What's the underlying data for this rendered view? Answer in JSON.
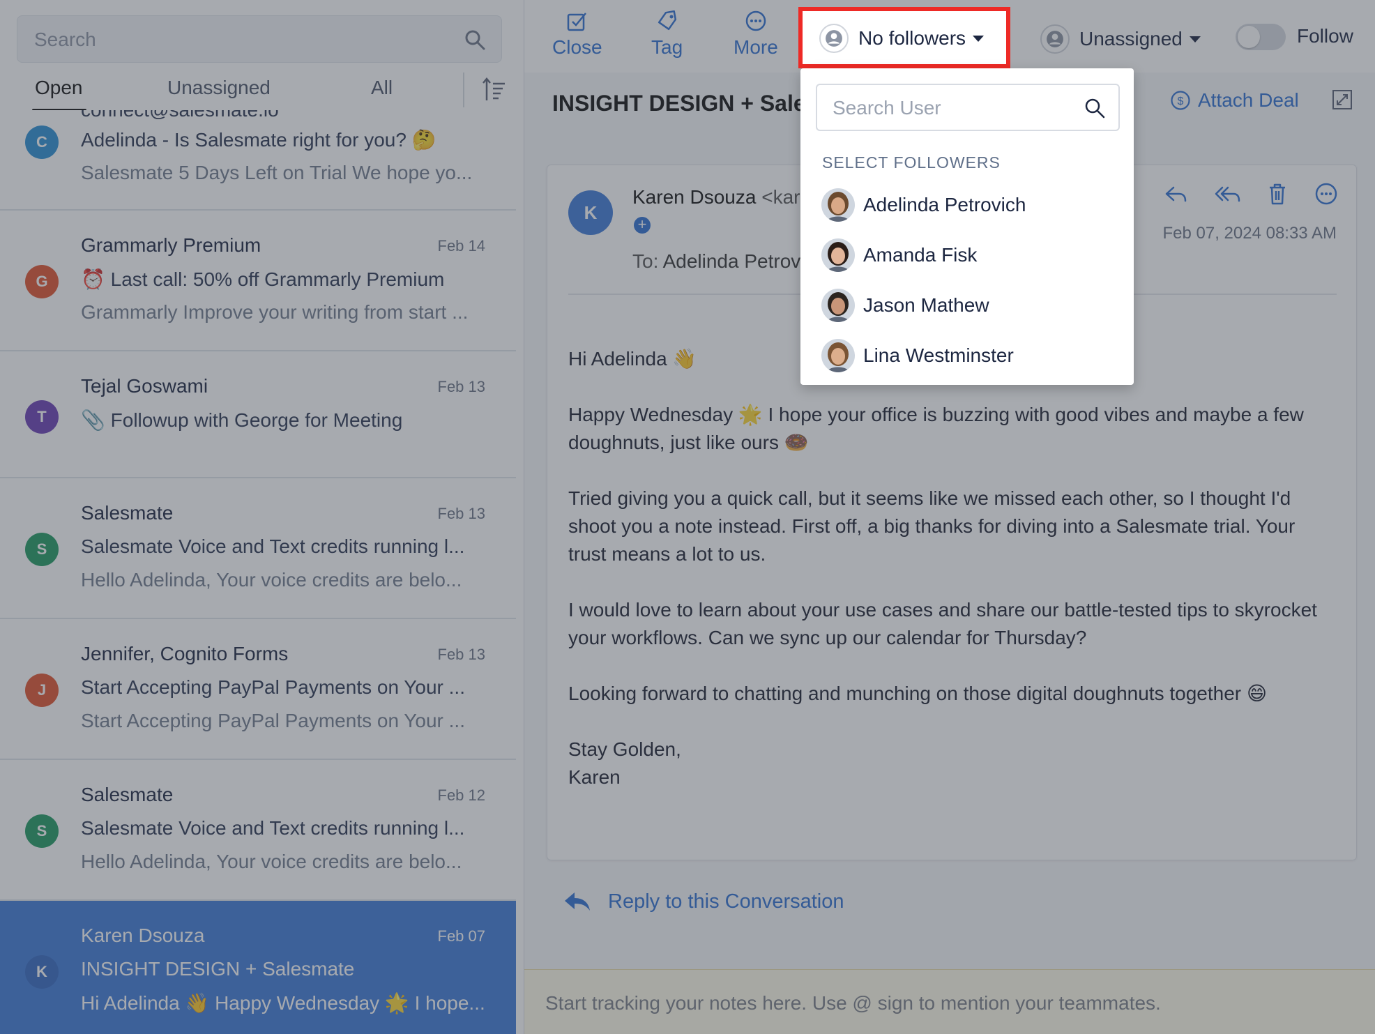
{
  "left_panel": {
    "search": {
      "placeholder": "Search",
      "value": ""
    },
    "tabs": [
      {
        "label": "Open",
        "active": true
      },
      {
        "label": "Unassigned",
        "active": false
      },
      {
        "label": "All",
        "active": false
      }
    ],
    "partial_top_text": "connect@salesmate.io",
    "conversations": [
      {
        "initial": "C",
        "avatar_color": "#2a8fd4",
        "sender": "",
        "date": "",
        "subject": "Adelinda - Is Salesmate right for you? 🤔",
        "preview": "Salesmate 5 Days Left on Trial We hope yo..."
      },
      {
        "initial": "G",
        "avatar_color": "#e0532e",
        "sender": "Grammarly Premium",
        "date": "Feb 14",
        "subject": "⏰ Last call: 50% off Grammarly Premium",
        "preview": "Grammarly Improve your writing from start ..."
      },
      {
        "initial": "T",
        "avatar_color": "#6a3fb4",
        "sender": "Tejal Goswami",
        "date": "Feb 13",
        "subject": "📎 Followup with George for Meeting",
        "preview": ""
      },
      {
        "initial": "S",
        "avatar_color": "#1f9a62",
        "sender": "Salesmate",
        "date": "Feb 13",
        "subject": "Salesmate Voice and Text credits running l...",
        "preview": "Hello Adelinda, Your voice credits are belo..."
      },
      {
        "initial": "J",
        "avatar_color": "#e0532e",
        "sender": "Jennifer, Cognito Forms",
        "date": "Feb 13",
        "subject": "Start Accepting PayPal Payments on Your ...",
        "preview": "Start Accepting PayPal Payments on Your ..."
      },
      {
        "initial": "S",
        "avatar_color": "#1f9a62",
        "sender": "Salesmate",
        "date": "Feb 12",
        "subject": "Salesmate Voice and Text credits running l...",
        "preview": "Hello Adelinda, Your voice credits are belo..."
      },
      {
        "initial": "K",
        "avatar_color": "#3468c2",
        "sender": "Karen Dsouza",
        "date": "Feb 07",
        "subject": "INSIGHT DESIGN + Salesmate",
        "preview": "Hi Adelinda 👋 Happy Wednesday 🌟 I hope...",
        "selected": true
      }
    ]
  },
  "toolbar": {
    "close_label": "Close",
    "tag_label": "Tag",
    "more_label": "More",
    "followers_label": "No followers",
    "assignee_label": "Unassigned",
    "follow_label": "Follow",
    "follow_on": false
  },
  "conversation": {
    "title": "INSIGHT DESIGN + Salesmate",
    "attach_deal_label": "Attach Deal"
  },
  "email": {
    "avatar_initial": "K",
    "from_name": "Karen Dsouza",
    "from_email": "<karen@insightdesign.com>",
    "to_label": "To:",
    "to_value": "Adelinda Petrovich",
    "timestamp": "Feb 07, 2024 08:33 AM",
    "body": [
      "Hi Adelinda 👋",
      "Happy Wednesday 🌟 I hope your office is buzzing with good vibes and maybe a few doughnuts, just like ours 🍩",
      "Tried giving you a quick call, but it seems like we missed each other, so I thought I'd shoot you a note instead. First off, a big thanks for diving into a Salesmate trial. Your trust means a lot to us.",
      "I would love to learn about your use cases and share our battle-tested tips to skyrocket your workflows. Can we sync up our calendar for Thursday?",
      "Looking forward to chatting and munching on those digital doughnuts together 😄"
    ],
    "signoff": "Stay Golden,",
    "signature": "Karen"
  },
  "reply_label": "Reply to this Conversation",
  "notes_placeholder": "Start tracking your notes here. Use @ sign to mention your teammates.",
  "followers_dropdown": {
    "search_placeholder": "Search User",
    "heading": "SELECT FOLLOWERS",
    "users": [
      {
        "name": "Adelinda Petrovich",
        "hair": "#6b4a2e",
        "skin": "#d9a987"
      },
      {
        "name": "Amanda Fisk",
        "hair": "#2a1d18",
        "skin": "#e2b59a"
      },
      {
        "name": "Jason Mathew",
        "hair": "#2b241f",
        "skin": "#c99679"
      },
      {
        "name": "Lina Westminster",
        "hair": "#7a5434",
        "skin": "#dcae8c"
      }
    ]
  },
  "colors": {
    "accent": "#2f6fd1",
    "highlight_border": "#ee2a26",
    "selected_row": "#3e7ad8"
  }
}
